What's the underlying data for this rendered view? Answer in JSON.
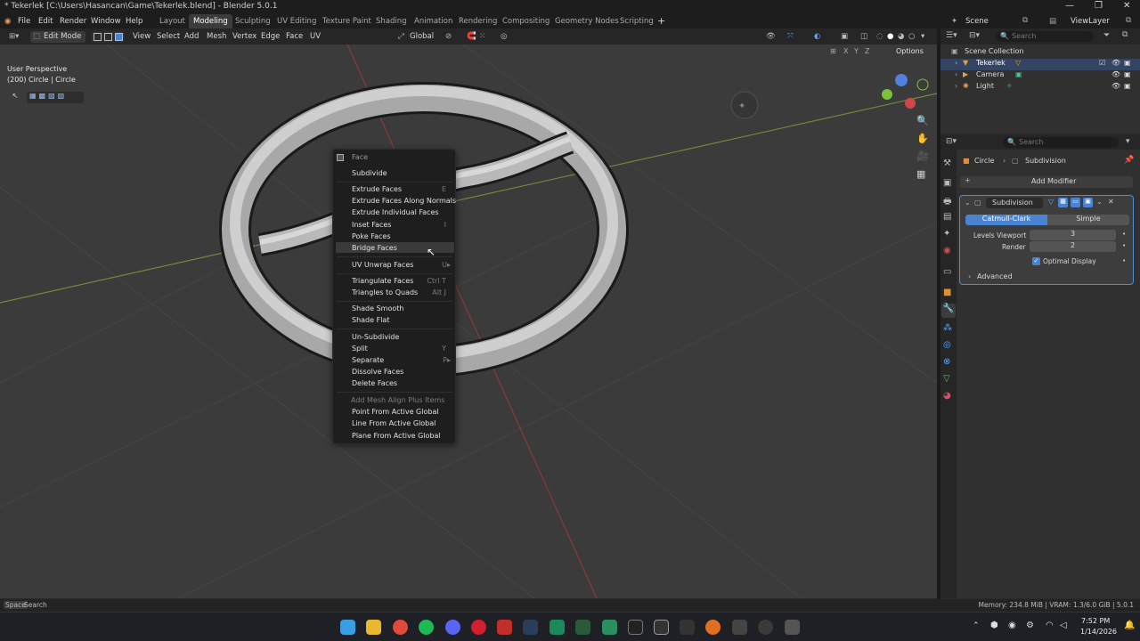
{
  "window": {
    "title": "* Tekerlek [C:\\Users\\Hasancan\\Game\\Tekerlek.blend] - Blender 5.0.1",
    "controls": [
      "—",
      "❐",
      "✕"
    ]
  },
  "menu": [
    "File",
    "Edit",
    "Render",
    "Window",
    "Help"
  ],
  "workspaces": [
    "Layout",
    "Modeling",
    "Sculpting",
    "UV Editing",
    "Texture Paint",
    "Shading",
    "Animation",
    "Rendering",
    "Compositing",
    "Geometry Nodes",
    "Scripting"
  ],
  "active_workspace": "Modeling",
  "scene": "Scene",
  "view_layer": "ViewLayer",
  "header": {
    "mode": "Edit Mode",
    "view": "View",
    "select": "Select",
    "add": "Add",
    "mesh": "Mesh",
    "vertex": "Vertex",
    "edge": "Edge",
    "face": "Face",
    "uv": "UV",
    "orientation": "Global",
    "options": "Options",
    "axes": [
      "X",
      "Y",
      "Z"
    ]
  },
  "viewport": {
    "perspective": "User Perspective",
    "object_info": "(200) Circle | Circle"
  },
  "context_menu": {
    "title": "Face",
    "items": [
      {
        "label": "Subdivide",
        "shortcut": ""
      },
      {
        "label": "Extrude Faces",
        "shortcut": "E"
      },
      {
        "label": "Extrude Faces Along Normals",
        "shortcut": ""
      },
      {
        "label": "Extrude Individual Faces",
        "shortcut": ""
      },
      {
        "label": "Inset Faces",
        "shortcut": "I"
      },
      {
        "label": "Poke Faces",
        "shortcut": ""
      },
      {
        "label": "Bridge Faces",
        "shortcut": ""
      },
      {
        "label": "UV Unwrap Faces",
        "shortcut": "U▸"
      },
      {
        "label": "Triangulate Faces",
        "shortcut": "Ctrl T"
      },
      {
        "label": "Triangles to Quads",
        "shortcut": "Alt J"
      },
      {
        "label": "Shade Smooth",
        "shortcut": ""
      },
      {
        "label": "Shade Flat",
        "shortcut": ""
      },
      {
        "label": "Un-Subdivide",
        "shortcut": ""
      },
      {
        "label": "Split",
        "shortcut": "Y"
      },
      {
        "label": "Separate",
        "shortcut": "P▸"
      },
      {
        "label": "Dissolve Faces",
        "shortcut": ""
      },
      {
        "label": "Delete Faces",
        "shortcut": ""
      },
      {
        "label": "Add Mesh Align Plus Items",
        "shortcut": ""
      },
      {
        "label": "Point From Active Global",
        "shortcut": ""
      },
      {
        "label": "Line From Active Global",
        "shortcut": ""
      },
      {
        "label": "Plane From Active Global",
        "shortcut": ""
      }
    ]
  },
  "outliner": {
    "search_placeholder": "Search",
    "collection": "Scene Collection",
    "objects": [
      "Tekerlek",
      "Camera",
      "Light"
    ]
  },
  "properties": {
    "search_placeholder": "Search",
    "breadcrumb_object": "Circle",
    "breadcrumb_modifier": "Subdivision",
    "add_modifier": "Add Modifier",
    "modifier_name": "Subdivision",
    "tab_catmull": "Catmull-Clark",
    "tab_simple": "Simple",
    "levels_viewport_label": "Levels Viewport",
    "levels_viewport": "3",
    "render_label": "Render",
    "render": "2",
    "optimal_display": "Optimal Display",
    "advanced": "Advanced"
  },
  "status": {
    "key": "Space",
    "action": "Search",
    "right": "Memory: 234.8 MiB | VRAM: 1.3/6.0 GiB | 5.0.1"
  },
  "taskbar": {
    "time": "7:52 PM",
    "date": "1/14/2026"
  }
}
